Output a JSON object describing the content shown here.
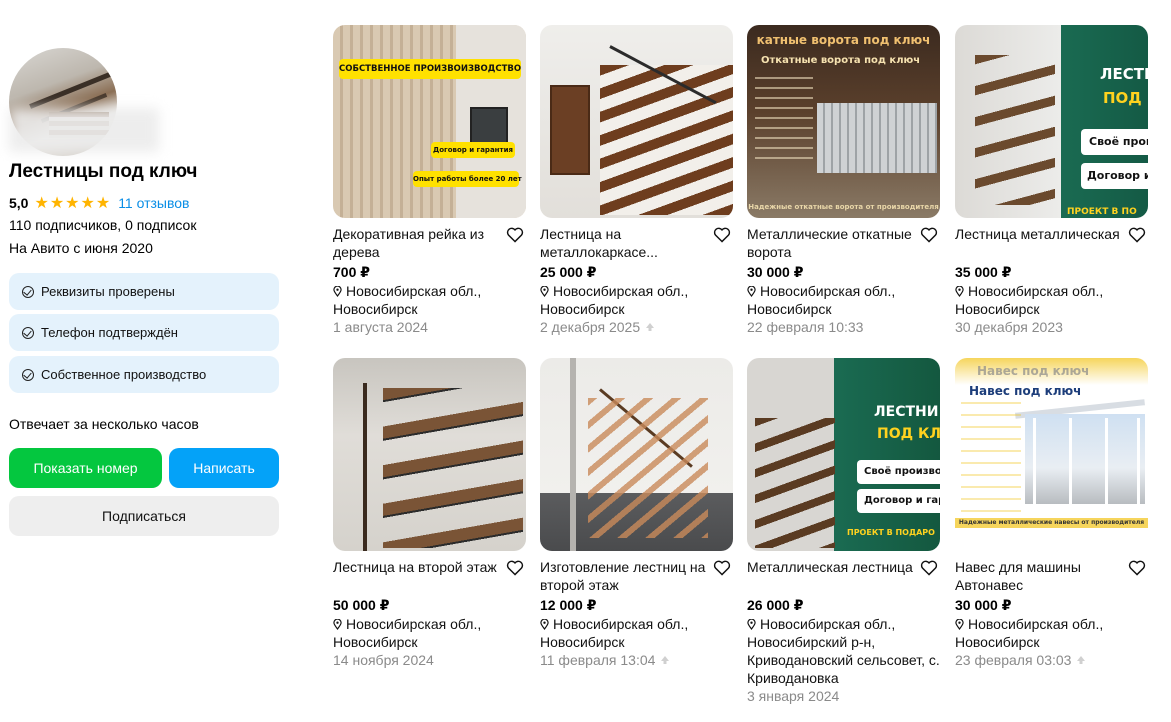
{
  "profile": {
    "name": "Лестницы под ключ",
    "rating": "5,0",
    "stars": "★★★★★",
    "reviews": "11 отзывов",
    "subscribers": "110 подписчиков, 0 подписок",
    "since": "На Авито с июня 2020",
    "badges": [
      {
        "label": "Реквизиты проверены"
      },
      {
        "label": "Телефон подтверждён"
      },
      {
        "label": "Собственное производство"
      }
    ],
    "responds": "Отвечает за несколько часов",
    "show_phone": "Показать номер",
    "write": "Написать",
    "subscribe": "Подписаться"
  },
  "listings": [
    {
      "title": "Декоративная рейка из дерева",
      "price": "700 ₽",
      "location": "Новосибирская обл., Новосибирск",
      "date": "1 августа 2024",
      "image_text": [
        "СОБСТВЕННОЕ ПРОИЗВОИЗВОДСТВО",
        "Договор и гарантия",
        "Опыт работы более 20 лет"
      ]
    },
    {
      "title": "Лестница на металлокаркасе...",
      "price": "25 000 ₽",
      "location": "Новосибирская обл., Новосибирск",
      "date": "2 декабря 2025"
    },
    {
      "title": "Металлические откатные ворота",
      "price": "30 000 ₽",
      "location": "Новосибирская обл., Новосибирск",
      "date": "22 февраля 10:33",
      "image_text": [
        "катные ворота под ключ",
        "Откатные ворота под ключ",
        "Надежные откатные ворота от производителя"
      ]
    },
    {
      "title": "Лестница металлическая",
      "price": "35 000 ₽",
      "location": "Новосибирская обл., Новосибирск",
      "date": "30 декабря 2023",
      "image_text": [
        "ЛЕСТНИ",
        "ПОД",
        "Своё прои",
        "Договор и",
        "ПРОЕКТ В ПО"
      ]
    },
    {
      "title": "Лестница на второй этаж",
      "price": "50 000 ₽",
      "location": "Новосибирская обл., Новосибирск",
      "date": "14 ноября 2024"
    },
    {
      "title": "Изготовление лестниц на второй этаж",
      "price": "12 000 ₽",
      "location": "Новосибирская обл., Новосибирск",
      "date": "11 февраля 13:04"
    },
    {
      "title": "Металлическая лестница",
      "price": "26 000 ₽",
      "location": "Новосибирская обл., Новосибирский р-н, Криводановский сельсовет, с. Криводановка",
      "date": "3 января 2024",
      "image_text": [
        "ЛЕСТНИ",
        "ПОД КЛЮ",
        "Своё производ",
        "Договор и гара",
        "ПРОЕКТ В ПОДАРО"
      ]
    },
    {
      "title": "Навес для машины Автонавес",
      "price": "30 000 ₽",
      "location": "Новосибирская обл., Новосибирск",
      "date": "23 февраля 03:03",
      "image_text": [
        "Навес под ключ",
        "Навес под ключ",
        "Надежные металлические навесы от производителя"
      ]
    }
  ],
  "colors": {
    "green_button": "#04c73f",
    "blue_button": "#04a2f8",
    "badge_bg": "#e4f2fc",
    "link": "#0a8ee6",
    "star": "#ffb400"
  }
}
